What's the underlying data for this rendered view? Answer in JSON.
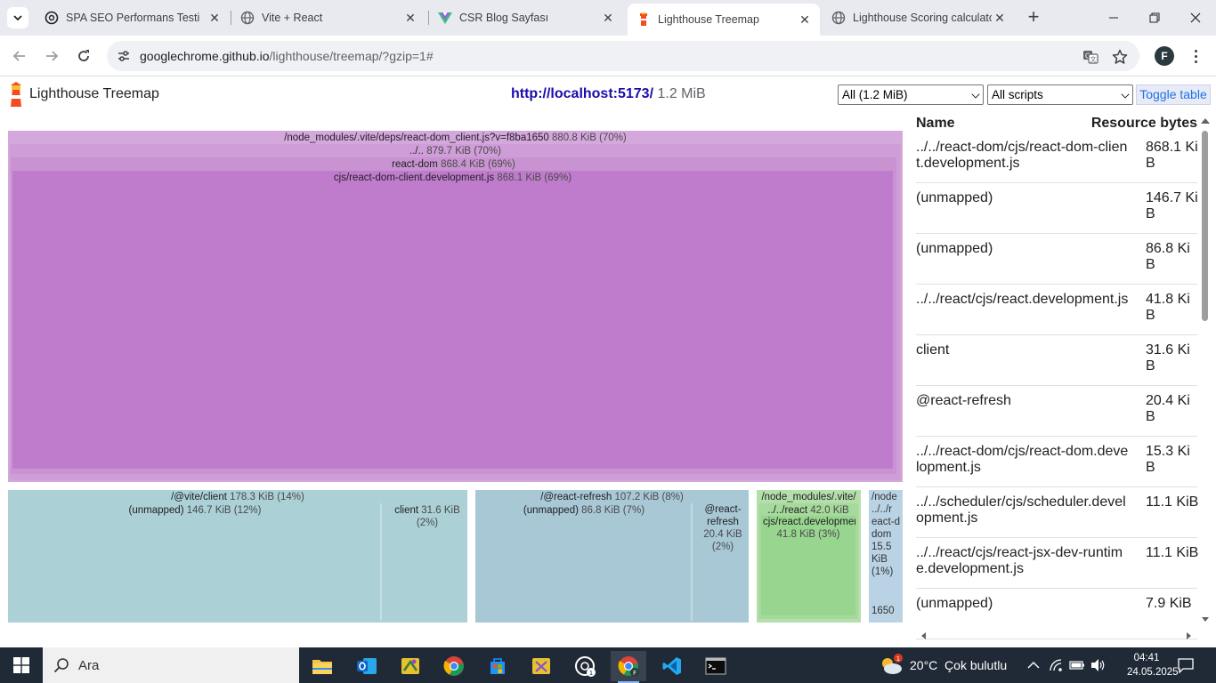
{
  "browser": {
    "tabs": [
      {
        "title": "SPA SEO Performans Testi",
        "icon": "openai-icon"
      },
      {
        "title": "Vite + React",
        "icon": "globe-icon"
      },
      {
        "title": "CSR Blog Sayfası",
        "icon": "vue-logo-icon"
      },
      {
        "title": "Lighthouse Treemap",
        "icon": "lighthouse-icon",
        "active": true
      },
      {
        "title": "Lighthouse Scoring calculato",
        "icon": "globe-icon"
      }
    ],
    "url_host": "googlechrome.github.io",
    "url_path": "/lighthouse/treemap/?gzip=1#",
    "profile_initial": "F"
  },
  "header": {
    "title": "Lighthouse Treemap",
    "url": "http://localhost:5173/",
    "size": "1.2 MiB",
    "filter_selected": "All (1.2 MiB)",
    "scripts_selected": "All scripts",
    "toggle_label": "Toggle table"
  },
  "treemap": {
    "react_dom_client": {
      "label": "/node_modules/.vite/deps/react-dom_client.js?v=f8ba1650",
      "size": "880.8 KiB (70%)"
    },
    "parent": {
      "label": "../..",
      "size": "879.7 KiB (70%)"
    },
    "react_dom": {
      "label": "react-dom",
      "size": "868.4 KiB (69%)"
    },
    "cjs_client": {
      "label": "cjs/react-dom-client.development.js",
      "size": "868.1 KiB (69%)"
    },
    "vite_client": {
      "label": "/@vite/client",
      "size": "178.3 KiB (14%)"
    },
    "vite_unmapped": {
      "label": "(unmapped)",
      "size": "146.7 KiB (12%)"
    },
    "vite_client_child": {
      "label": "client",
      "size": "31.6 KiB (2%)"
    },
    "react_refresh": {
      "label": "/@react-refresh",
      "size": "107.2 KiB (8%)"
    },
    "refresh_unmapped": {
      "label": "(unmapped)",
      "size": "86.8 KiB (7%)"
    },
    "refresh_child": {
      "label": "@react-refresh",
      "size": "20.4 KiB (2%)"
    },
    "node_vite": {
      "label": "/node_modules/.vite/",
      "sub": "../../react",
      "sub_size": "42.0 KiB",
      "child": "cjs/react.development.js",
      "child_size": "41.8 KiB (3%)"
    },
    "tiny": {
      "label": "/node",
      "l1": "../../r",
      "l2": "eact-d",
      "l3": "dom",
      "l4": "15.5",
      "l5": "KiB",
      "l6": "(1%)",
      "l7": "1650"
    }
  },
  "table": {
    "col_name": "Name",
    "col_bytes": "Resource bytes",
    "rows": [
      {
        "name": "../../react-dom/cjs/react-dom-client.development.js",
        "bytes": "868.1 KiB"
      },
      {
        "name": "(unmapped)",
        "bytes": "146.7 KiB"
      },
      {
        "name": "(unmapped)",
        "bytes": "86.8 KiB"
      },
      {
        "name": "../../react/cjs/react.development.js",
        "bytes": "41.8 KiB"
      },
      {
        "name": "client",
        "bytes": "31.6 KiB"
      },
      {
        "name": "@react-refresh",
        "bytes": "20.4 KiB"
      },
      {
        "name": "../../react-dom/cjs/react-dom.development.js",
        "bytes": "15.3 KiB"
      },
      {
        "name": "../../scheduler/cjs/scheduler.development.js",
        "bytes": "11.1 KiB"
      },
      {
        "name": "../../react/cjs/react-jsx-dev-runtime.development.js",
        "bytes": "11.1 KiB"
      },
      {
        "name": "(unmapped)",
        "bytes": "7.9 KiB"
      }
    ]
  },
  "taskbar": {
    "search_placeholder": "Ara",
    "weather": "20°C  Çok bulutlu",
    "weather_badge": "1",
    "time": "04:41",
    "date": "24.05.2025"
  },
  "colors": {
    "purple": "#c07ccc",
    "teal": "#abd0d6",
    "blue": "#a9c8d6",
    "green": "#98d690"
  }
}
